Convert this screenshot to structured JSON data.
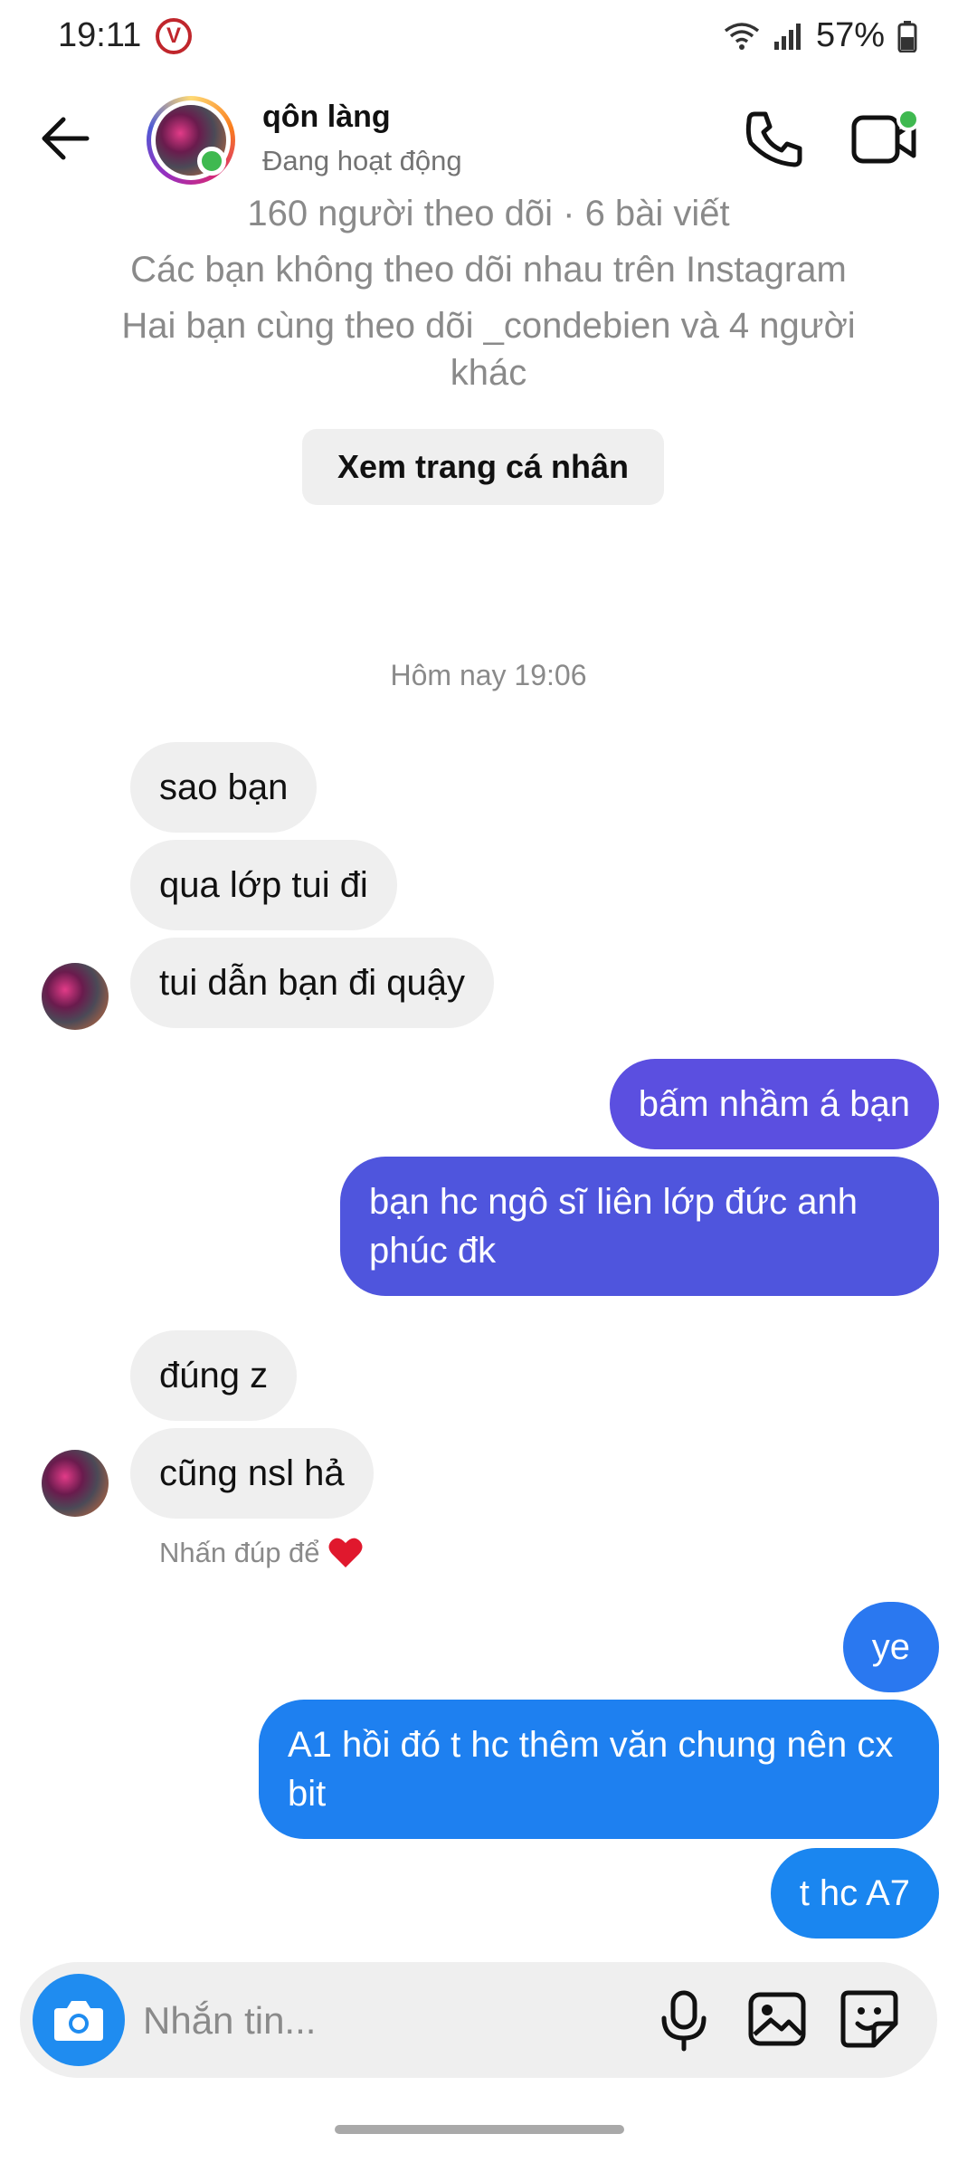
{
  "status_bar": {
    "time": "19:11",
    "badge": "V",
    "battery": "57%"
  },
  "header": {
    "name": "qôn làng",
    "status": "Đang hoạt động"
  },
  "profile": {
    "stats": "160 người theo dõi · 6 bài viết",
    "follow_note": "Các bạn không theo dõi nhau trên Instagram",
    "mutual_line1": "Hai bạn cùng theo dõi _condebien và 4 người",
    "mutual_line2": "khác",
    "view_profile_label": "Xem trang cá nhân"
  },
  "timestamp": "Hôm nay 19:06",
  "messages": {
    "m1": "sao bạn",
    "m2": "qua lớp tui đi",
    "m3": "tui dẫn bạn đi quậy",
    "m4": "bấm nhầm á bạn",
    "m5": "bạn hc ngô sĩ liên lớp đức anh phúc đk",
    "m6": "đúng z",
    "m7": "cũng nsl hả",
    "m8": "ye",
    "m9": "A1 hồi đó t hc thêm văn chung nên cx bit",
    "m10": "t hc A7"
  },
  "reaction_hint": {
    "text": "Nhấn đúp để",
    "icon": "heart-icon"
  },
  "composer": {
    "placeholder": "Nhắn tin...",
    "value": ""
  },
  "colors": {
    "accent_blue": "#1f8cf0",
    "sent_purple": "#5b4fe0",
    "sent_blue": "#1e7ff0",
    "online_green": "#3fb950",
    "received_bg": "#efefef"
  }
}
